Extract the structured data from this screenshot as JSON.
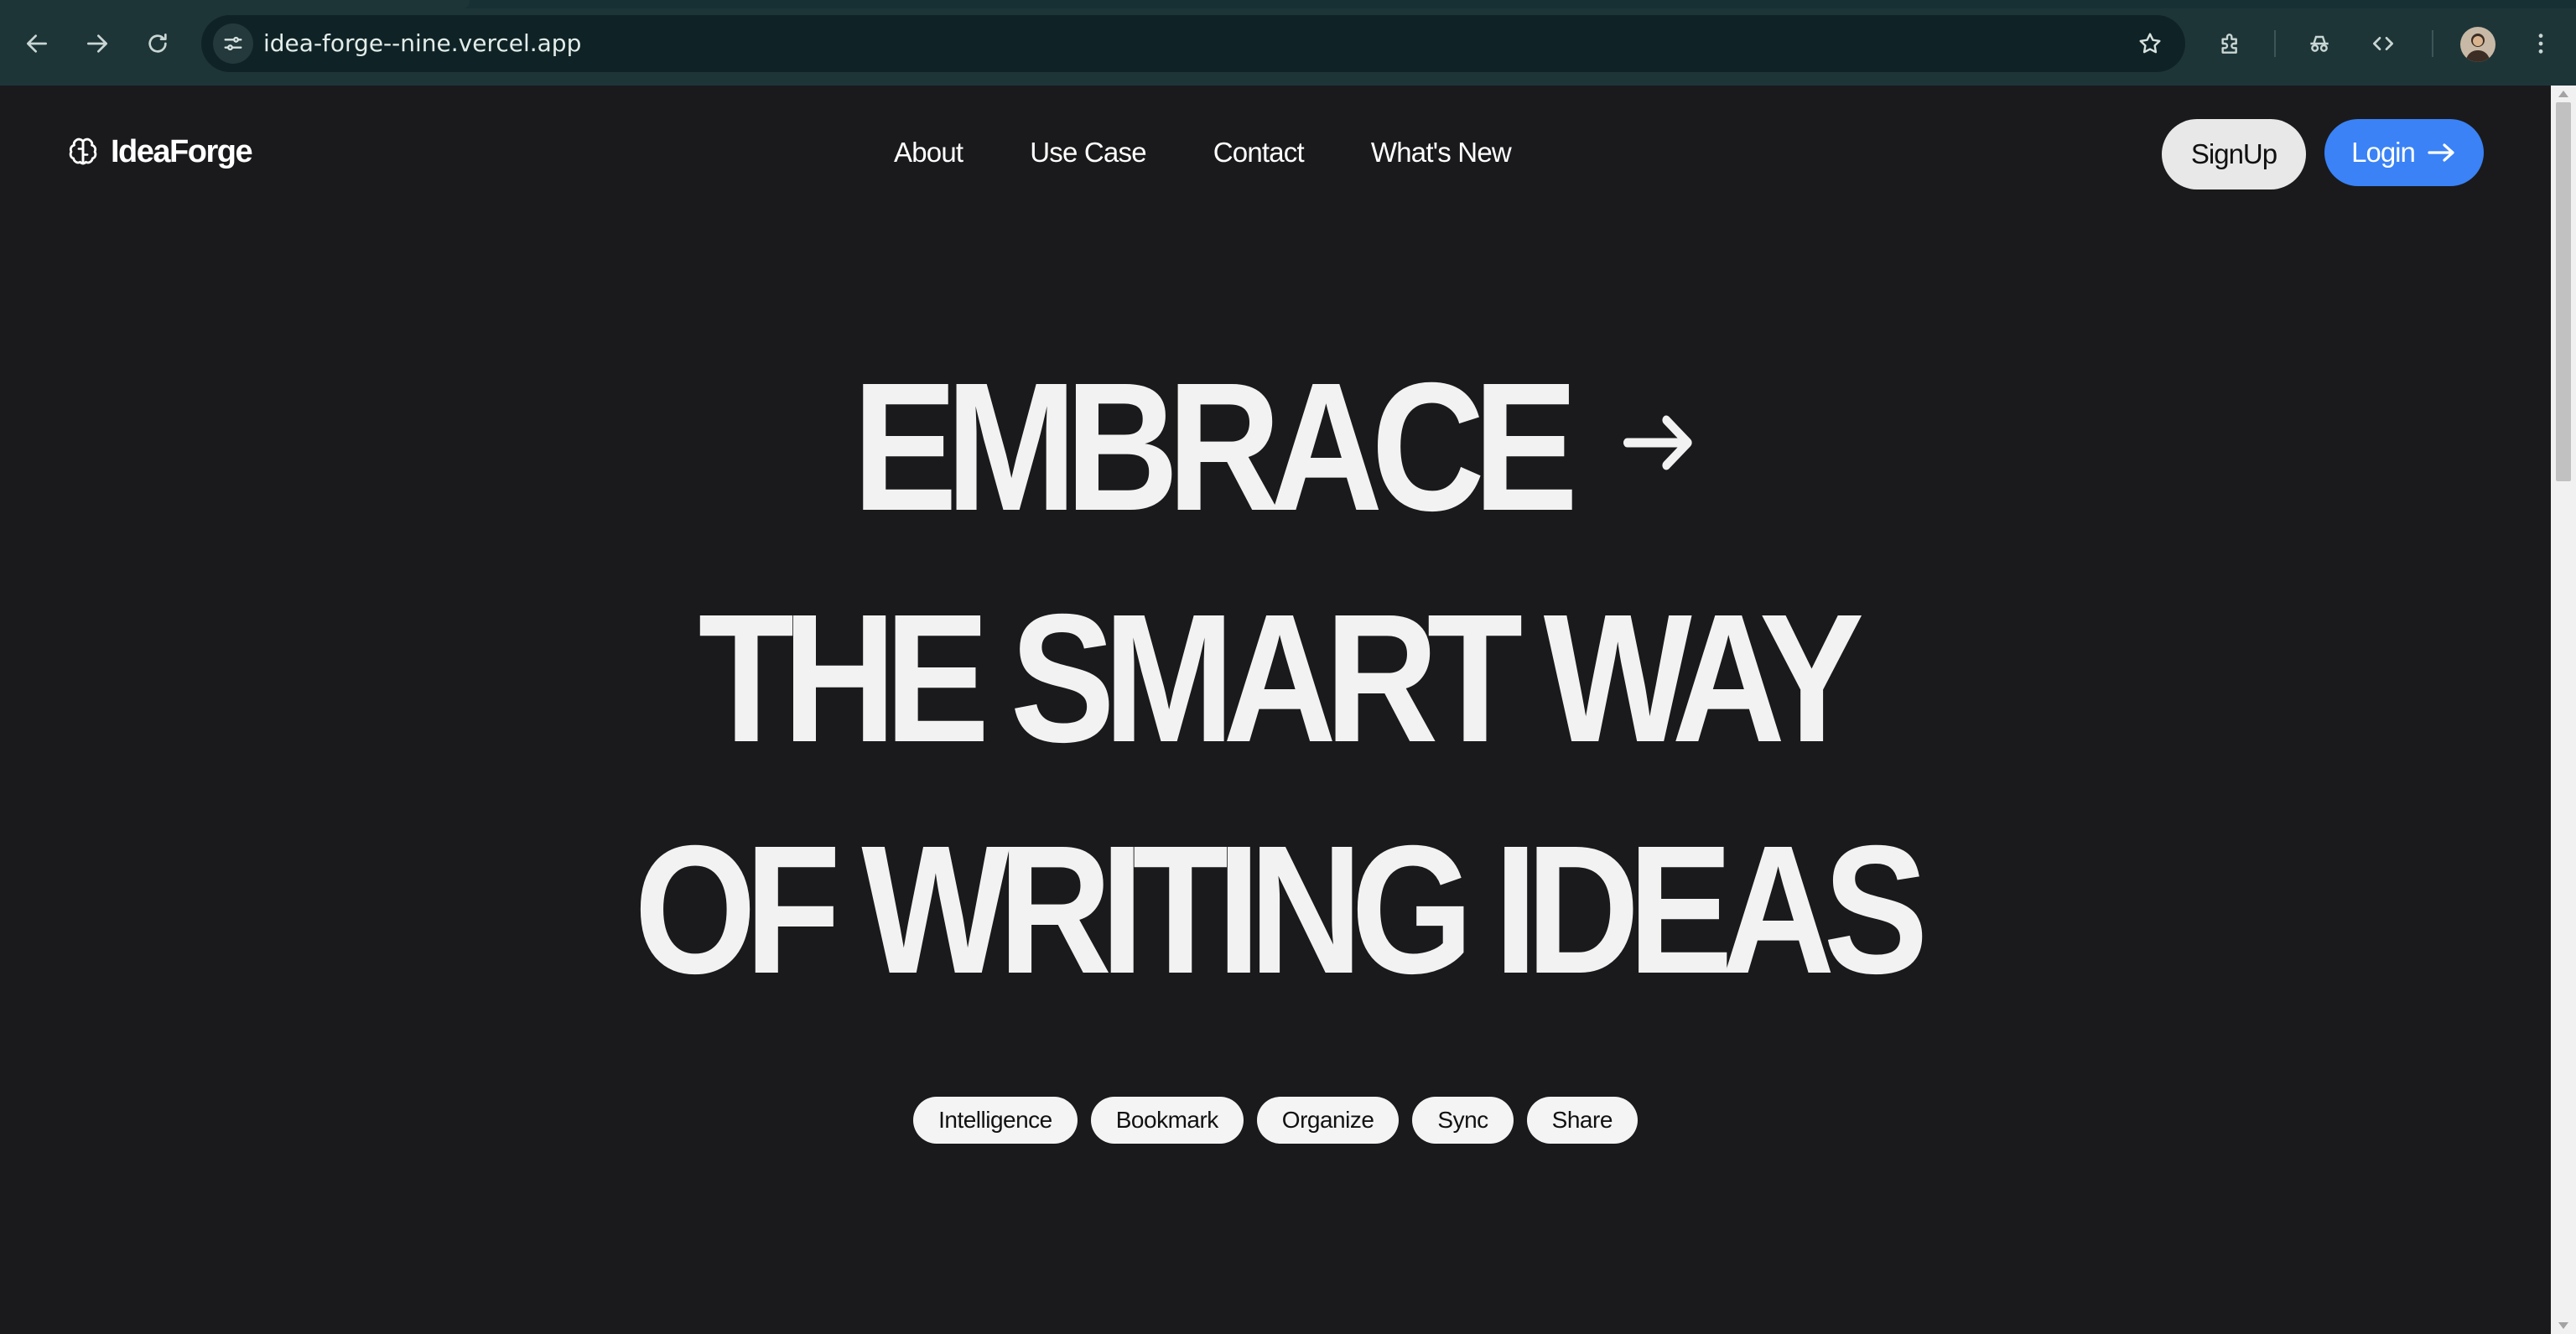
{
  "browser": {
    "url": "idea-forge--nine.vercel.app"
  },
  "nav": {
    "logo_text": "IdeaForge",
    "links": [
      "About",
      "Use Case",
      "Contact",
      "What's New"
    ],
    "signup_label": "SignUp",
    "login_label": "Login"
  },
  "hero": {
    "line1": "EMBRACE",
    "line2": "THE SMART WAY",
    "line3": "OF WRITING IDEAS"
  },
  "chips": [
    "Intelligence",
    "Bookmark",
    "Organize",
    "Sync",
    "Share"
  ],
  "colors": {
    "page_bg": "#1a1a1c",
    "login_button": "#3a82f6",
    "signup_button": "#e8e8e8",
    "chrome_bg": "#1e3538"
  }
}
